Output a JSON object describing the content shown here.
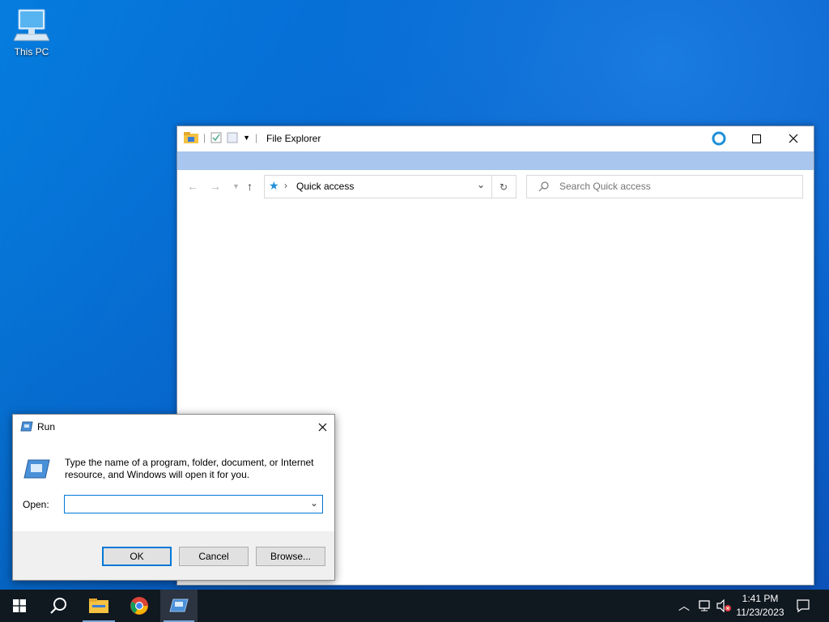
{
  "desktop": {
    "icons": [
      {
        "label": "This PC",
        "icon": "computer-icon"
      }
    ]
  },
  "explorer": {
    "title": "File Explorer",
    "address": "Quick access",
    "search_placeholder": "Search Quick access",
    "accent_color": "#a8c6ee"
  },
  "run_dialog": {
    "title": "Run",
    "description": "Type the name of a program, folder, document, or Internet resource, and Windows will open it for you.",
    "open_label": "Open:",
    "open_value": "",
    "buttons": {
      "ok": "OK",
      "cancel": "Cancel",
      "browse": "Browse..."
    }
  },
  "taskbar": {
    "pinned": [
      "start-icon",
      "search-icon",
      "file-explorer-icon",
      "chrome-icon",
      "run-icon"
    ],
    "time": "1:41 PM",
    "date": "11/23/2023"
  }
}
